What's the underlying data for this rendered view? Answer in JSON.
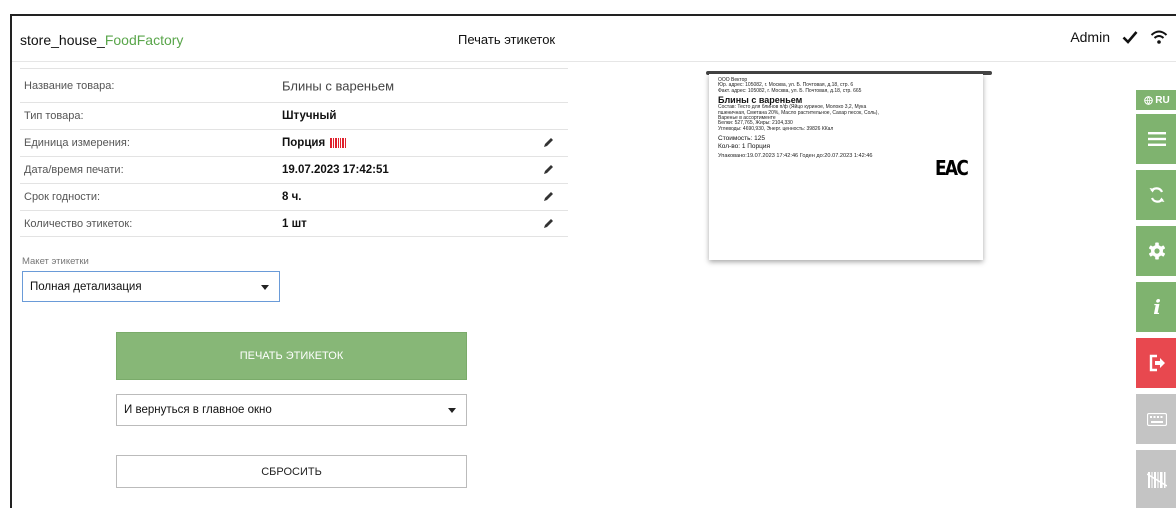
{
  "header": {
    "app_name_prefix": "store_house_",
    "app_name_brand": "FoodFactory",
    "page_title": "Печать этикеток",
    "user": "Admin"
  },
  "fields": [
    {
      "label": "Название товара:",
      "value": "Блины с вареньем",
      "editable": false
    },
    {
      "label": "Тип товара:",
      "value": "Штучный",
      "editable": false
    },
    {
      "label": "Единица измерения:",
      "value": "Порция",
      "editable": true
    },
    {
      "label": "Дата/время печати:",
      "value": "19.07.2023 17:42:51",
      "editable": true
    },
    {
      "label": "Срок годности:",
      "value": "8 ч.",
      "editable": true
    },
    {
      "label": "Количество этикеток:",
      "value": "1 шт",
      "editable": true
    }
  ],
  "layout": {
    "label": "Макет этикетки",
    "selected": "Полная детализация"
  },
  "actions": {
    "print_label": "ПЕЧАТЬ ЭТИКЕТОК",
    "after_print_selected": "И вернуться в главное окно",
    "reset_label": "СБРОСИТЬ"
  },
  "preview": {
    "line1": "ООО Вектор",
    "line2": "Юр. адрес: 105082, г. Москва, ул. Б. Почтовая, д.18, стр. 6",
    "line3": "Факт. адрес: 105082, г. Москва, ул. Б. Почтовая, д.18, стр. 665",
    "product": "Блины с вареньем",
    "comp1": "Состав: Тесто для блинов п/ф (Яйцо куриное, Молоко 3,2, Мука",
    "comp2": "пшеничная, Сметана 20%, Масло растительное, Сахар песок, Соль),",
    "comp3": "Варенье в ассортименте",
    "nutr1": "Белки: 527,765, Жиры: 2104,330",
    "nutr2": "Углеводы: 4690,930, Энерг. ценность: 39826 ККал",
    "cost": "Стоимость: 125",
    "qty": "Кол-во: 1 Порция",
    "dates": "Упаковано:19.07.2023 17:42:46  Годен до:20.07.2023 1:42:46",
    "mark": "ЕАС"
  },
  "toolbar": {
    "lang": "RU",
    "items": [
      "menu-icon",
      "sync-icon",
      "gear-icon",
      "info-icon",
      "logout-icon",
      "keyboard-icon",
      "barcode-scan-icon"
    ]
  },
  "colors": {
    "brand_green": "#5aa64b",
    "button_green": "#87b777",
    "toolbar_green": "#7fb36f",
    "danger_red": "#e8484f",
    "disabled_grey": "#c4c4c4"
  }
}
